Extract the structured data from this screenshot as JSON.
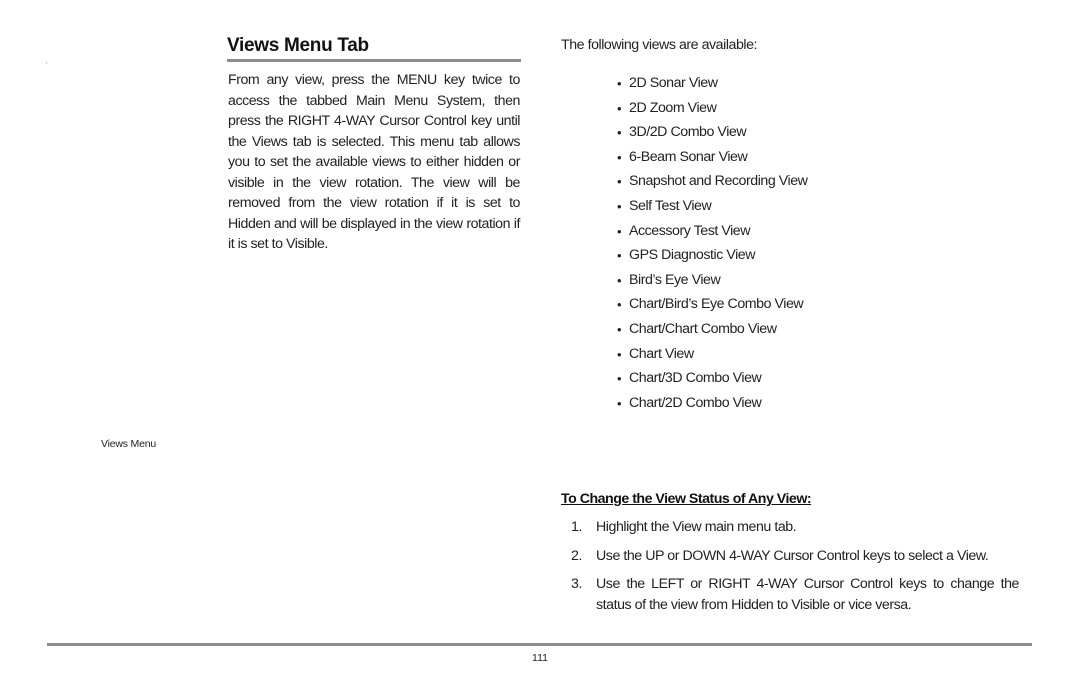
{
  "section": {
    "title": "Views Menu Tab",
    "intro": "From any view, press the MENU key twice to access the tabbed Main Menu System, then press the RIGHT 4-WAY Cursor Control key until the Views tab is selected. This menu tab allows you to set the available views to either hidden or visible in the view rotation. The view will be removed from the view rotation if it is set to Hidden and will be displayed in the view rotation if it is set to Visible."
  },
  "figure": {
    "caption": "Views Menu"
  },
  "views": {
    "intro": "The following views are available:",
    "bullet": "•",
    "items": [
      "2D Sonar View",
      "2D Zoom View",
      "3D/2D Combo View",
      "6-Beam Sonar View",
      "Snapshot and Recording View",
      "Self Test View",
      "Accessory Test View",
      "GPS Diagnostic View",
      "Bird’s Eye View",
      "Chart/Bird’s Eye Combo View",
      "Chart/Chart Combo View",
      "Chart View",
      "Chart/3D Combo View",
      "Chart/2D Combo View"
    ]
  },
  "procedure": {
    "heading": "To Change the View Status of Any View:",
    "steps": [
      {
        "num": "1.",
        "text": "Highlight the View main menu tab."
      },
      {
        "num": "2.",
        "text": "Use the UP or DOWN 4-WAY Cursor Control keys to select a View."
      },
      {
        "num": "3.",
        "text": "Use the LEFT or RIGHT 4-WAY Cursor Control keys to change the status of the view from Hidden to Visible or vice versa."
      }
    ]
  },
  "footer": {
    "page_number": "111"
  }
}
